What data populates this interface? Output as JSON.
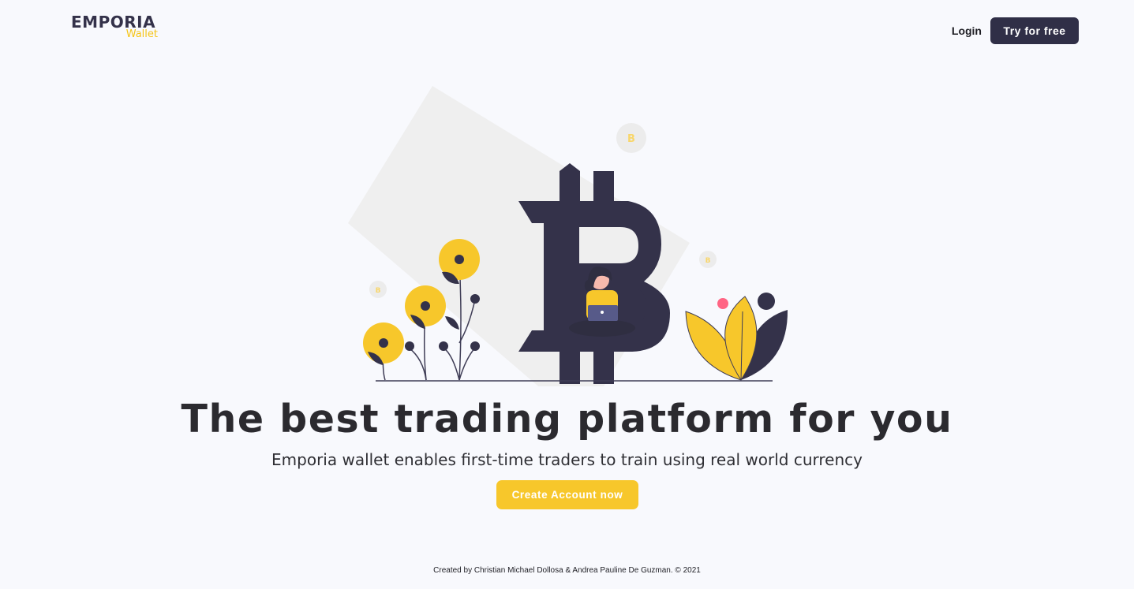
{
  "brand": {
    "name": "EMPORIA",
    "sub": "Wallet",
    "primary_color": "#34324a",
    "accent_color": "#f5c518"
  },
  "nav": {
    "login_label": "Login",
    "try_label": "Try for free"
  },
  "hero": {
    "headline": "The best trading platform for you",
    "subheadline": "Emporia wallet enables first-time traders to train using real world currency",
    "cta_label": "Create Account now",
    "illustration": "bitcoin-trader-illustration",
    "coin_glyph": "B"
  },
  "footer": {
    "text": "Created by Christian Michael Dollosa & Andrea Pauline De Guzman. © 2021"
  },
  "colors": {
    "background": "#f8f9fd",
    "dark": "#34324a",
    "yellow": "#f7c72b",
    "pink": "#ff6584"
  }
}
